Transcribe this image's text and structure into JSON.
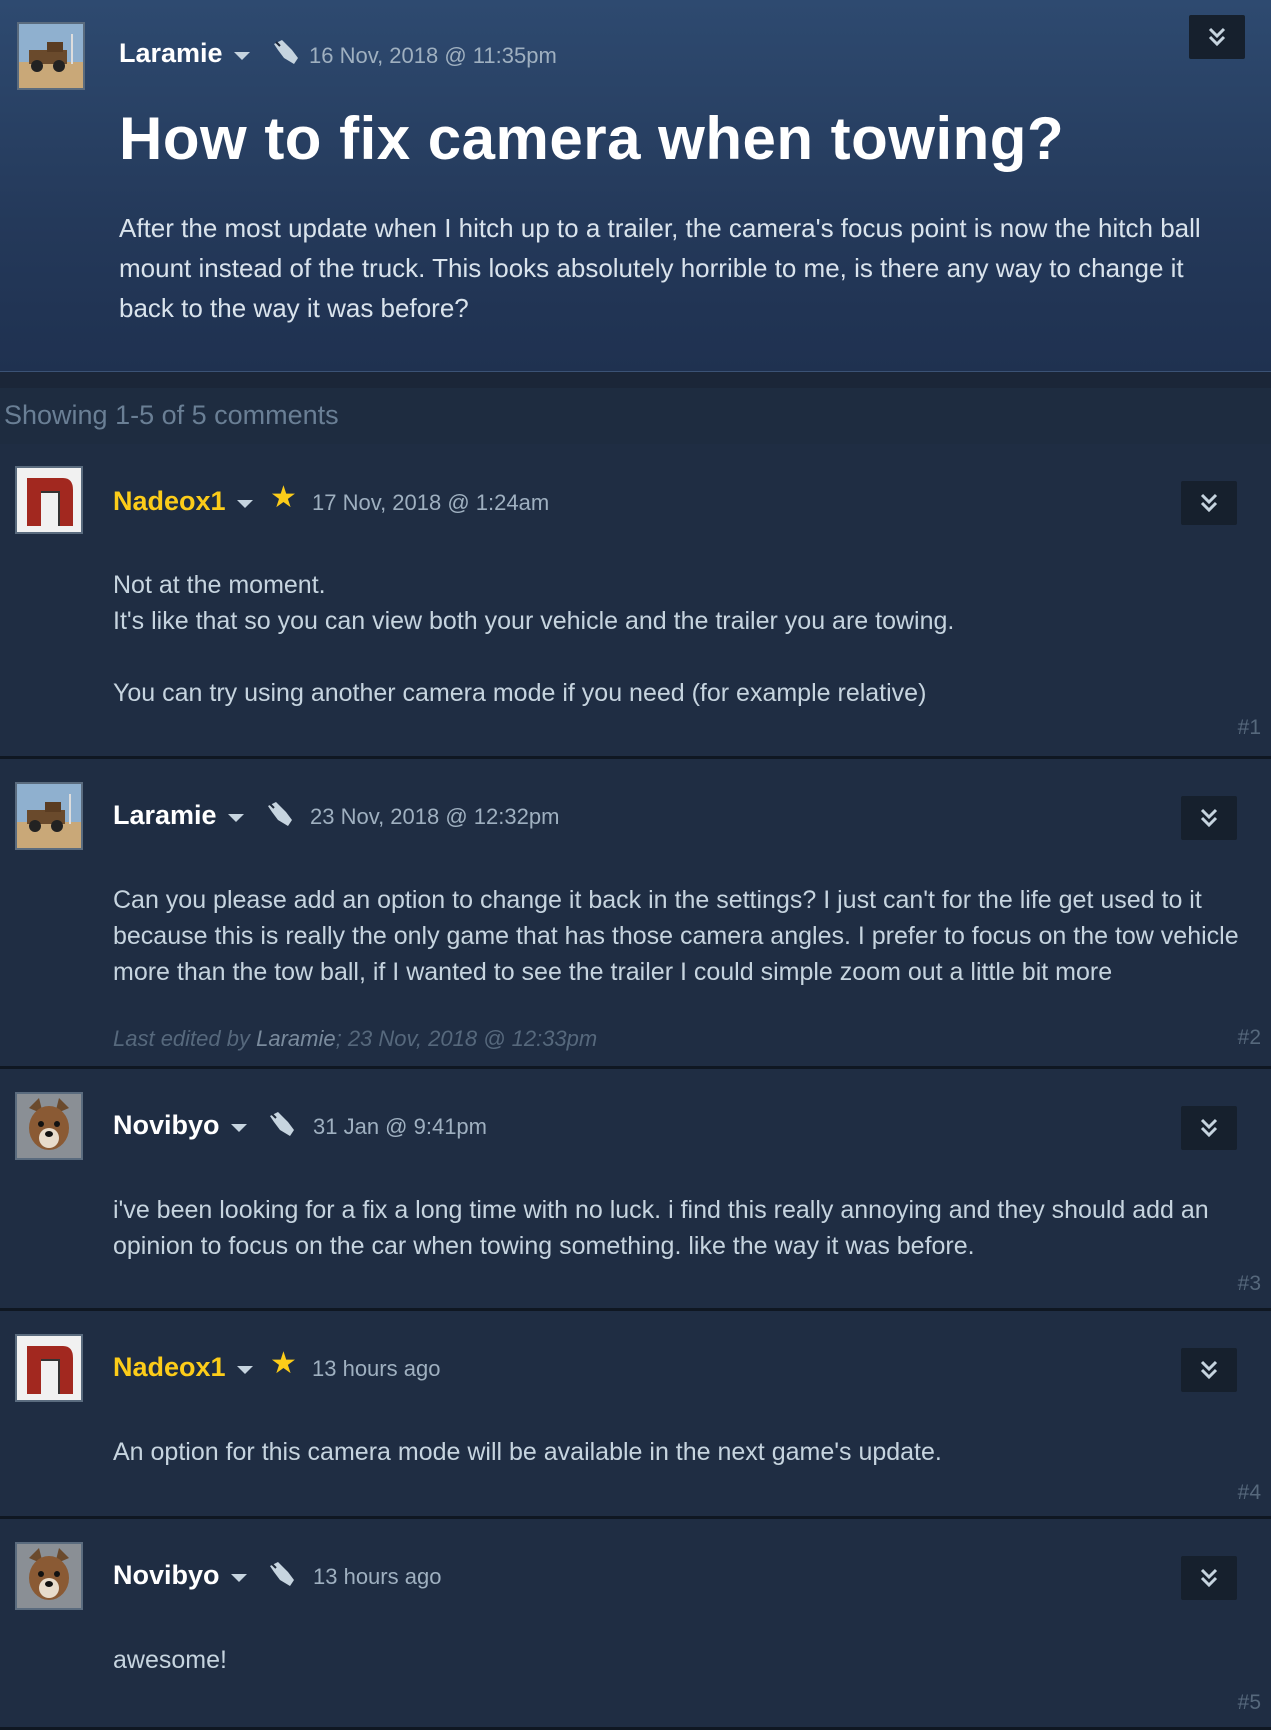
{
  "original_post": {
    "author": "Laramie",
    "date": "16 Nov, 2018 @ 11:35pm",
    "title": "How to fix camera when towing?",
    "body": "After the most update when I hitch up to a trailer, the camera's focus point is now the hitch ball mount instead of the truck. This looks absolutely horrible to me, is there any way to change it back to the way it was before?"
  },
  "comments_summary": "Showing 1-5 of 5 comments",
  "comments": [
    {
      "author": "Nadeox1",
      "developer": true,
      "date": "17 Nov, 2018 @ 1:24am",
      "lines": [
        "Not at the moment.",
        "It's like that so you can view both your vehicle and the trailer you are towing.",
        "",
        "You can try using another camera mode if you need (for example relative)"
      ],
      "number": "#1"
    },
    {
      "author": "Laramie",
      "developer": false,
      "date": "23 Nov, 2018 @ 12:32pm",
      "lines": [
        "Can you please add an option to change it back in the settings? I just can't for the life get used to it because this is really the only game that has those camera angles. I prefer to focus on the tow vehicle more than the tow ball, if I wanted to see the trailer I could simple zoom out a little bit more"
      ],
      "edited_prefix": "Last edited by ",
      "edited_by": "Laramie",
      "edited_date": "; 23 Nov, 2018 @ 12:33pm",
      "number": "#2"
    },
    {
      "author": "Novibyo",
      "developer": false,
      "date": "31 Jan @ 9:41pm",
      "lines": [
        "i've been looking for a fix a long time with no luck. i find this really annoying and they should add an opinion to focus on the car when towing something. like the way it was before."
      ],
      "number": "#3"
    },
    {
      "author": "Nadeox1",
      "developer": true,
      "date": "13 hours ago",
      "lines": [
        "An option for this camera mode will be available in the next game's update."
      ],
      "number": "#4"
    },
    {
      "author": "Novibyo",
      "developer": false,
      "date": "13 hours ago",
      "lines": [
        "awesome!"
      ],
      "number": "#5"
    }
  ],
  "colors": {
    "developer_name": "#fccc19",
    "user_name": "#ffffff",
    "background": "#1b2638"
  },
  "icons": [
    "truck-avatar",
    "n-logo-avatar",
    "dog-avatar",
    "platform-badge-icon",
    "developer-star-icon",
    "chevron-double-down-icon",
    "dropdown-caret-icon"
  ]
}
